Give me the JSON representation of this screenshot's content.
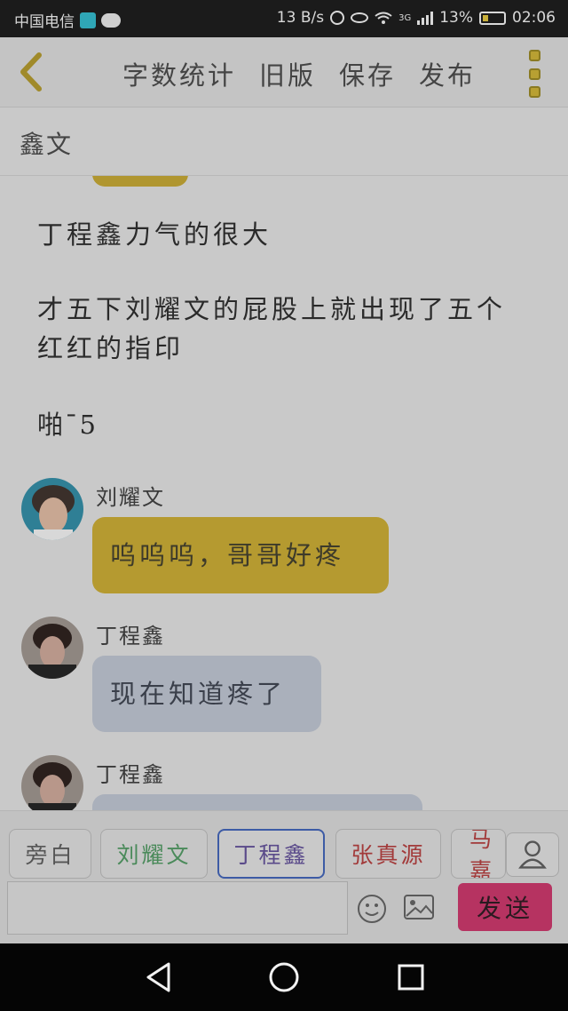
{
  "status_bar": {
    "carrier": "中国电信",
    "speed": "13 B/s",
    "network": "3G",
    "battery": "13%",
    "time": "02:06"
  },
  "toolbar": {
    "items": [
      "字数统计",
      "旧版",
      "保存",
      "发布"
    ]
  },
  "story": {
    "title": "鑫文"
  },
  "content": {
    "narration_1": "丁程鑫力气的很大",
    "narration_2": "才五下刘耀文的屁股上就出现了五个红红的指印",
    "narration_3": "啪ˉ5",
    "messages": [
      {
        "sender": "刘耀文",
        "text": "呜呜呜，哥哥好疼"
      },
      {
        "sender": "丁程鑫",
        "text": "现在知道疼了"
      },
      {
        "sender": "丁程鑫",
        "text": ""
      }
    ]
  },
  "characters": {
    "chips": [
      "旁白",
      "刘耀文",
      "丁程鑫",
      "张真源",
      "马嘉"
    ]
  },
  "input": {
    "value": "",
    "send_label": "发送"
  },
  "colors": {
    "accent_yellow": "#b59a30",
    "send_pink": "#b63361",
    "active_chip_border": "#3d5ba5",
    "chip_colors": [
      "#555555",
      "#4a8a5a",
      "#5a4a8a",
      "#a23a3a",
      "#a23a3a"
    ]
  },
  "icons": {
    "back": "chevron-left-icon",
    "more": "vertical-dots-icon",
    "contact": "person-icon",
    "emoji": "smiley-icon",
    "image": "image-icon",
    "nav_back": "triangle-back-icon",
    "nav_home": "circle-home-icon",
    "nav_recent": "square-recent-icon"
  }
}
